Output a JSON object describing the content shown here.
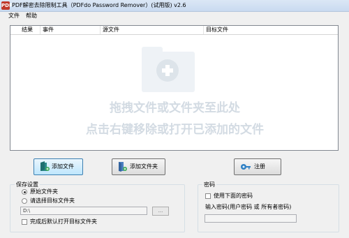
{
  "window": {
    "icon_text": "PDF",
    "title": "PDF解密去除限制工具（PDFdo Password Remover）(试用版) v2.6"
  },
  "menu": {
    "file": "文件",
    "help": "帮助"
  },
  "list": {
    "columns": [
      "结果",
      "事件",
      "源文件",
      "目标文件"
    ],
    "hint_line1": "拖拽文件或文件夹至此处",
    "hint_line2": "点击右键移除或打开已添加的文件"
  },
  "buttons": {
    "add_file": "添加文件",
    "add_folder": "添加文件夹",
    "register": "注册"
  },
  "save_settings": {
    "title": "保存设置",
    "option_original": "原始文件夹",
    "option_choose": "请选择目标文件夹",
    "selected": "原始文件夹",
    "path_value": "D:\\",
    "browse_label": "...",
    "open_after": "完成后默认打开目标文件夹",
    "open_after_checked": false
  },
  "password": {
    "title": "密码",
    "use_below": "使用下面的密码",
    "use_below_checked": false,
    "input_label": "输入密码(用户密码 或 所有者密码)",
    "input_value": ""
  }
}
